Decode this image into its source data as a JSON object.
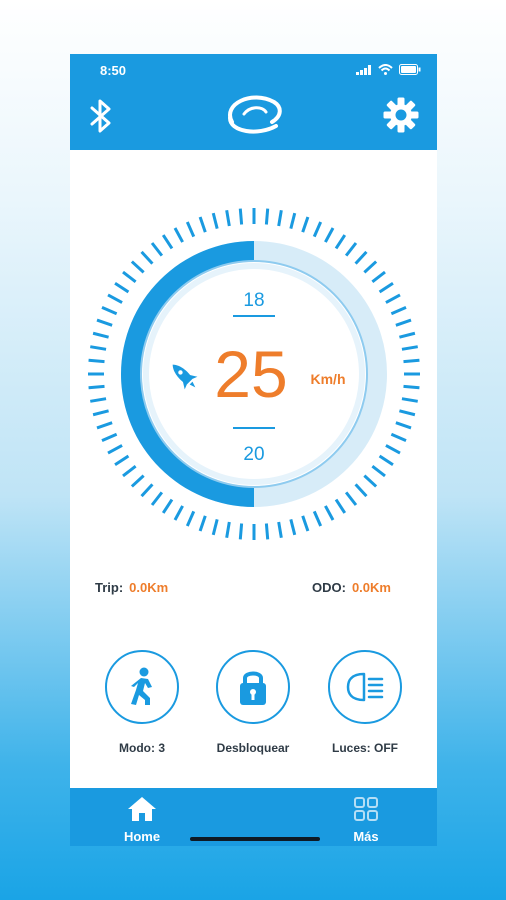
{
  "status": {
    "time": "8:50"
  },
  "header": {
    "left_icon": "bluetooth-icon",
    "center_icon": "brand-logo",
    "right_icon": "gear-icon"
  },
  "gauge": {
    "speed": "25",
    "unit": "Km/h",
    "top_value": "18",
    "bottom_value": "20",
    "progress": 0.5,
    "accent": "#1a9ae0",
    "speed_color": "#ee7d2b",
    "icon": "rocket-icon"
  },
  "stats": {
    "trip_label": "Trip:",
    "trip_value": "0.0Km",
    "odo_label": "ODO:",
    "odo_value": "0.0Km"
  },
  "actions": [
    {
      "label": "Modo: 3",
      "icon": "walking-person-icon"
    },
    {
      "label": "Desbloquear",
      "icon": "lock-icon"
    },
    {
      "label": "Luces: OFF",
      "icon": "headlight-icon"
    }
  ],
  "tabs": [
    {
      "label": "Home",
      "icon": "home-icon"
    },
    {
      "label": "Más",
      "icon": "grid-icon"
    }
  ]
}
